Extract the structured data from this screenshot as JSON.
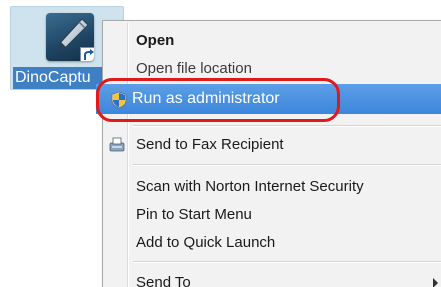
{
  "desktop": {
    "shortcut": {
      "label": "DinoCaptu"
    }
  },
  "context_menu": {
    "items": [
      {
        "label": "Open"
      },
      {
        "label": "Open file location"
      },
      {
        "label": "Run as administrator",
        "icon": "uac-shield-icon"
      },
      {
        "label": "Send to Fax Recipient",
        "icon": "fax-icon"
      },
      {
        "label": "Scan with Norton Internet Security"
      },
      {
        "label": "Pin to Start Menu"
      },
      {
        "label": "Add to Quick Launch"
      },
      {
        "label": "Send To"
      }
    ]
  },
  "colors": {
    "highlight": "#3c86dc",
    "annotation": "#e01a1a",
    "menu_background": "#f2f2f2"
  }
}
